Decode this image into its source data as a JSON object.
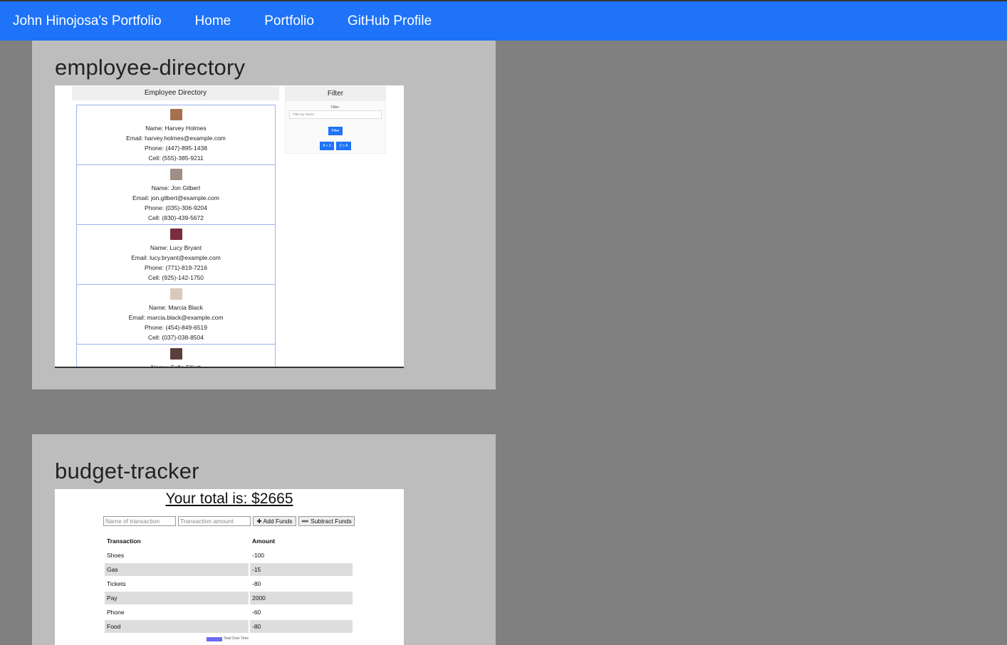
{
  "navbar": {
    "brand": "John Hinojosa's Portfolio",
    "links": [
      "Home",
      "Portfolio",
      "GitHub Profile"
    ],
    "background": "#1e73f8"
  },
  "projects": [
    {
      "title": "employee-directory",
      "screenshot": {
        "header": "Employee Directory",
        "employees": [
          {
            "name": "Name: Harvey Holmes",
            "email": "Email: harvey.holmes@example.com",
            "phone": "Phone: (447)-895-1438",
            "cell": "Cell: (555)-385-9211"
          },
          {
            "name": "Name: Jon Gilbert",
            "email": "Email: jon.gilbert@example.com",
            "phone": "Phone: (035)-306-9204",
            "cell": "Cell: (830)-439-5672"
          },
          {
            "name": "Name: Lucy Bryant",
            "email": "Email: lucy.bryant@example.com",
            "phone": "Phone: (771)-819-7216",
            "cell": "Cell: (925)-142-1750"
          },
          {
            "name": "Name: Marcia Black",
            "email": "Email: marcia.black@example.com",
            "phone": "Phone: (454)-849-6519",
            "cell": "Cell: (037)-038-8504"
          },
          {
            "name": "Name: Sofia Elliott"
          }
        ],
        "filter": {
          "title": "Filter",
          "label": "Filter:",
          "placeholder": "Filter By Name",
          "filter_button": "Filter",
          "sort_az": "A > Z",
          "sort_za": "Z > A"
        }
      }
    },
    {
      "title": "budget-tracker",
      "screenshot": {
        "total": "Your total is: $2665",
        "name_placeholder": "Name of transaction",
        "amount_placeholder": "Transaction amount",
        "add_button": "✚ Add Funds",
        "subtract_button": "➖ Subtract Funds",
        "table_headers": [
          "Transaction",
          "Amount"
        ],
        "rows": [
          [
            "Shoes",
            "-100"
          ],
          [
            "Gas",
            "-15"
          ],
          [
            "Tickets",
            "-80"
          ],
          [
            "Pay",
            "2000"
          ],
          [
            "Phone",
            "-60"
          ],
          [
            "Food",
            "-80"
          ]
        ],
        "legend": "Total Over Time"
      }
    }
  ]
}
